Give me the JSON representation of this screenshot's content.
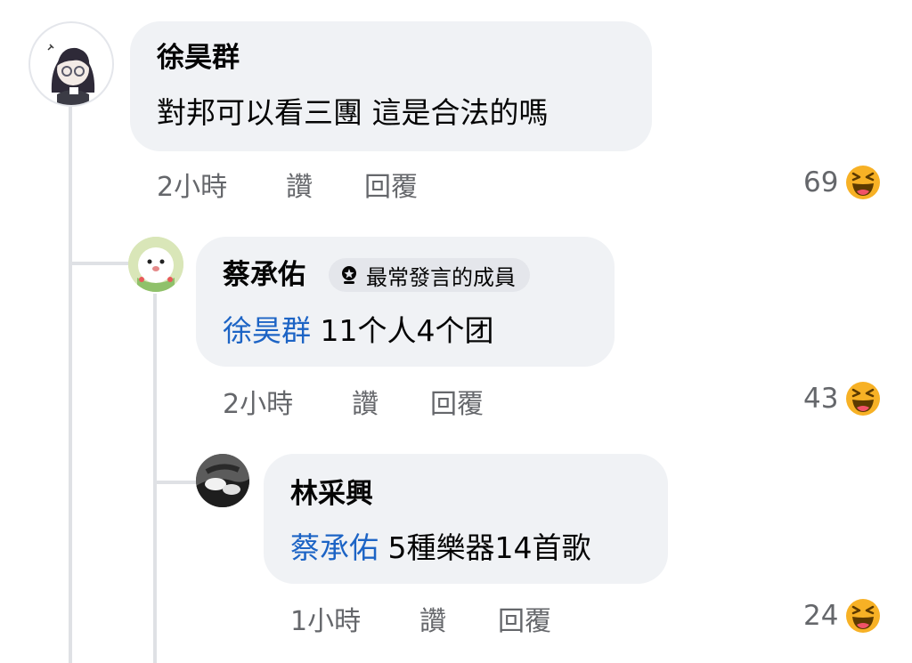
{
  "comments": [
    {
      "author": "徐昊群",
      "text": "對邦可以看三團 這是合法的嗎",
      "time": "2小時",
      "like_label": "讚",
      "reply_label": "回覆",
      "reaction_count": "69",
      "reaction_icon": "haha-emoji-icon"
    },
    {
      "author": "蔡承佑",
      "badge": "最常發言的成員",
      "badge_icon": "top-contributor-icon",
      "mention": "徐昊群",
      "text": "11个人4个团",
      "time": "2小時",
      "like_label": "讚",
      "reply_label": "回覆",
      "reaction_count": "43",
      "reaction_icon": "haha-emoji-icon"
    },
    {
      "author": "林采興",
      "mention": "蔡承佑",
      "text": "5種樂器14首歌",
      "time": "1小時",
      "like_label": "讚",
      "reply_label": "回覆",
      "reaction_count": "24",
      "reaction_icon": "haha-emoji-icon"
    }
  ],
  "colors": {
    "bubble": "#f0f2f5",
    "mention": "#1d64c5",
    "meta": "#65676b",
    "thread_line": "#dfe1e5"
  }
}
